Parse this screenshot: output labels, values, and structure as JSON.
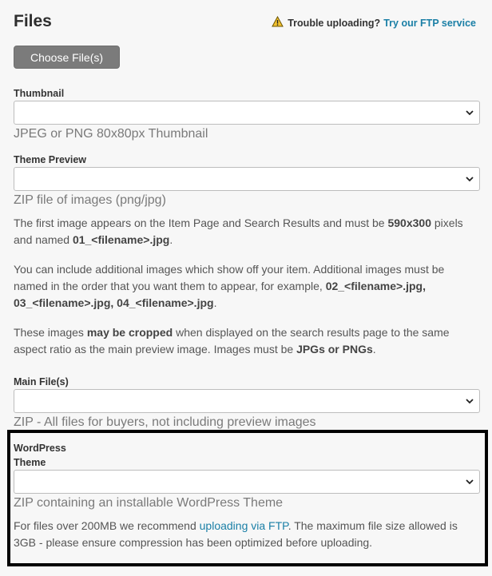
{
  "header": {
    "title": "Files",
    "trouble_text": "Trouble uploading?",
    "trouble_link": "Try our FTP service"
  },
  "upload": {
    "choose_label": "Choose File(s)"
  },
  "thumbnail": {
    "label": "Thumbnail",
    "selected": "",
    "hint": "JPEG or PNG 80x80px Thumbnail"
  },
  "theme_preview": {
    "label": "Theme Preview",
    "selected": "",
    "hint": "ZIP file of images (png/jpg)",
    "p1": {
      "a": "The first image appears on the Item Page and Search Results and must be ",
      "b": "590x300",
      "c": " pixels and named ",
      "d": "01_<filename>.jpg",
      "e": "."
    },
    "p2": {
      "a": "You can include additional images which show off your item. Additional images must be named in the order that you want them to appear, for example, ",
      "b": "02_<filename>.jpg, 03_<filename>.jpg, 04_<filename>.jpg",
      "c": "."
    },
    "p3": {
      "a": "These images ",
      "b": "may be cropped",
      "c": " when displayed on the search results page to the same aspect ratio as the main preview image. Images must be ",
      "d": "JPGs or PNGs",
      "e": "."
    }
  },
  "main_files": {
    "label": "Main File(s)",
    "selected": "",
    "hint": "ZIP - All files for buyers, not including preview images"
  },
  "wp_theme": {
    "label_line1": "WordPress",
    "label_line2": "Theme",
    "selected": "",
    "hint": "ZIP containing an installable WordPress Theme",
    "note_a": "For files over 200MB we recommend ",
    "note_link": "uploading via FTP",
    "note_b": ". The maximum file size allowed is 3GB - please ensure compression has been optimized before uploading."
  },
  "colors": {
    "link": "#1a7fa6",
    "button_bg": "#7b7b7b",
    "highlight_border": "#000000",
    "warning": "#f2c230"
  },
  "icons": [
    "warning-icon",
    "chevron-down-icon"
  ]
}
